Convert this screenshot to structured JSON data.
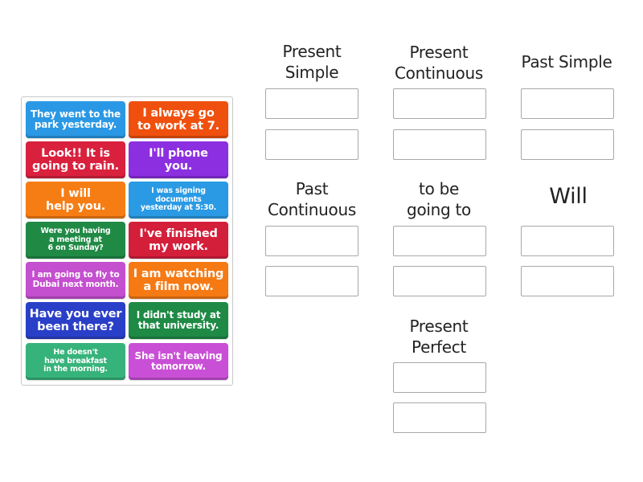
{
  "activity": {
    "type": "group-sort",
    "tiles": [
      {
        "text": "They went to the\npark yesterday.",
        "color": "#2a98e4"
      },
      {
        "text": "I always go\nto work at 7.",
        "color": "#f0500e"
      },
      {
        "text": "Look!! It is\ngoing to rain.",
        "color": "#d9213d"
      },
      {
        "text": "I'll phone\nyou.",
        "color": "#8c2fe0"
      },
      {
        "text": "I will\nhelp you.",
        "color": "#f67d14"
      },
      {
        "text": "I was signing\ndocuments\nyesterday at 5:30.",
        "color": "#2a9ae4"
      },
      {
        "text": "Were you having\na meeting at\n6 on Sunday?",
        "color": "#208a45"
      },
      {
        "text": "I've finished\nmy work.",
        "color": "#d41f3a"
      },
      {
        "text": "I am going to fly to\nDubai next month.",
        "color": "#c44fcf"
      },
      {
        "text": "I am watching\na film now.",
        "color": "#f67a14"
      },
      {
        "text": "Have you ever\nbeen there?",
        "color": "#2a3fc8"
      },
      {
        "text": "I didn't study at\nthat university.",
        "color": "#1e8a45"
      },
      {
        "text": "He doesn't\nhave breakfast\nin the morning.",
        "color": "#36b37a"
      },
      {
        "text": "She isn't leaving\ntomorrow.",
        "color": "#c94fd6"
      }
    ],
    "categories": [
      {
        "title": "Present\nSimple",
        "slots": 2
      },
      {
        "title": "Present\nContinuous",
        "slots": 2
      },
      {
        "title": "Past Simple",
        "slots": 2
      },
      {
        "title": "Past\nContinuous",
        "slots": 2
      },
      {
        "title": "to be\ngoing to",
        "slots": 2
      },
      {
        "title": "Will",
        "slots": 2
      },
      {
        "title": "Present\nPerfect",
        "slots": 2
      }
    ]
  }
}
